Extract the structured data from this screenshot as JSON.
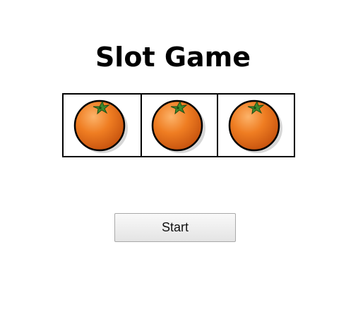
{
  "game": {
    "title": "Slot Game",
    "reels": [
      {
        "symbol": "orange-icon"
      },
      {
        "symbol": "orange-icon"
      },
      {
        "symbol": "orange-icon"
      }
    ],
    "start_label": "Start"
  },
  "colors": {
    "fruit": "#ef7d22",
    "fruit_dark": "#c24e0c",
    "fruit_light": "#fcb36a",
    "leaf": "#3f8a2e",
    "outline": "#000000"
  }
}
